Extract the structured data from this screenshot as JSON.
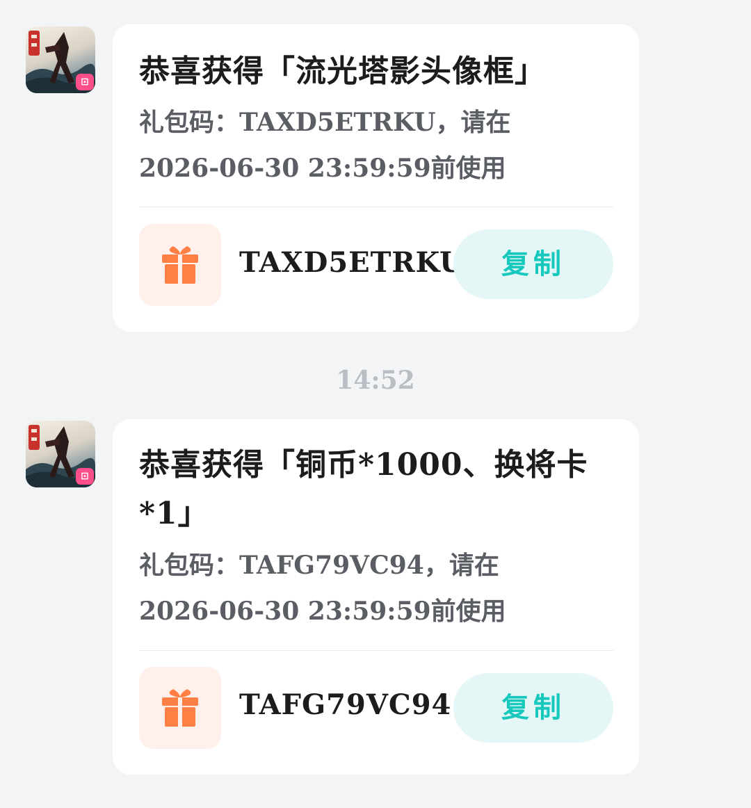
{
  "messages": [
    {
      "avatar_badge": "⊡",
      "title": "恭喜获得「流光塔影头像框」",
      "desc_line1": "礼包码：TAXD5ETRKU，请在",
      "desc_line2": "2026-06-30 23:59:59前使用",
      "code": "TAXD5ETRKU",
      "copy_label": "复制",
      "icons": {
        "avatar": "game-app-icon",
        "gift": "gift-icon"
      }
    },
    {
      "avatar_badge": "⊡",
      "title_line1": "恭喜获得「铜币*1000、换将卡",
      "title_line2": "*1」",
      "desc_line1": "礼包码：TAFG79VC94，请在",
      "desc_line2": "2026-06-30 23:59:59前使用",
      "code": "TAFG79VC94",
      "copy_label": "复制",
      "icons": {
        "avatar": "game-app-icon",
        "gift": "gift-icon"
      }
    }
  ],
  "timestamp": "14:52",
  "colors": {
    "background": "#f3f4f6",
    "card": "#ffffff",
    "accent_teal": "#17c9bd",
    "copy_button_bg": "#e4f7f6",
    "gift_orange": "#ff7f45",
    "gift_bg": "#fff0eb",
    "badge_pink": "#ff4f8b"
  }
}
